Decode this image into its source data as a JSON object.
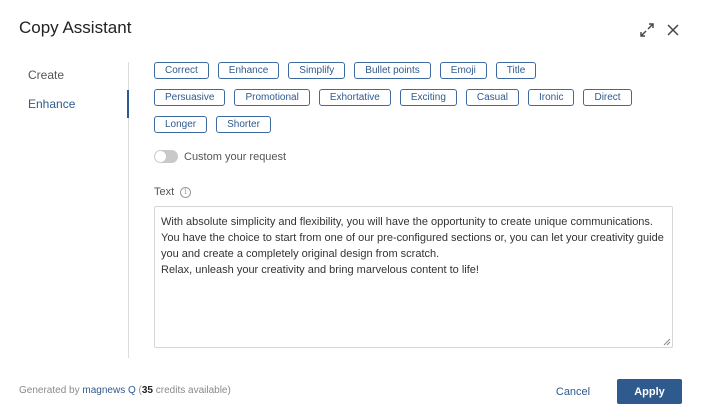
{
  "dialog": {
    "title": "Copy Assistant",
    "expand_icon": "expand-icon",
    "close_icon": "close-icon"
  },
  "nav": {
    "items": [
      {
        "label": "Create",
        "active": false
      },
      {
        "label": "Enhance",
        "active": true
      }
    ]
  },
  "chips": {
    "row1": [
      "Correct",
      "Enhance",
      "Simplify",
      "Bullet points",
      "Emoji",
      "Title"
    ],
    "row2": [
      "Persuasive",
      "Promotional",
      "Exhortative",
      "Exciting",
      "Casual",
      "Ironic",
      "Direct"
    ],
    "row3": [
      "Longer",
      "Shorter"
    ]
  },
  "custom_request": {
    "label": "Custom your request",
    "enabled": false
  },
  "text_field": {
    "label": "Text",
    "info_icon": "info-icon",
    "value": "With absolute simplicity and flexibility, you will have the opportunity to create unique communications.\nYou have the choice to start from one of our pre-configured sections or, you can let your creativity guide you and create a completely original design from scratch.\nRelax, unleash your creativity and bring marvelous content to life!"
  },
  "footer": {
    "generated_by": "Generated by",
    "brand": "magnews Q",
    "paren_open": "(",
    "credits_count": "35",
    "credits_text": "credits available)",
    "cancel_label": "Cancel",
    "apply_label": "Apply"
  },
  "colors": {
    "accent": "#2f5a8e",
    "chip_border": "#3d6aa1",
    "toggle_off": "#c9c9c9"
  }
}
